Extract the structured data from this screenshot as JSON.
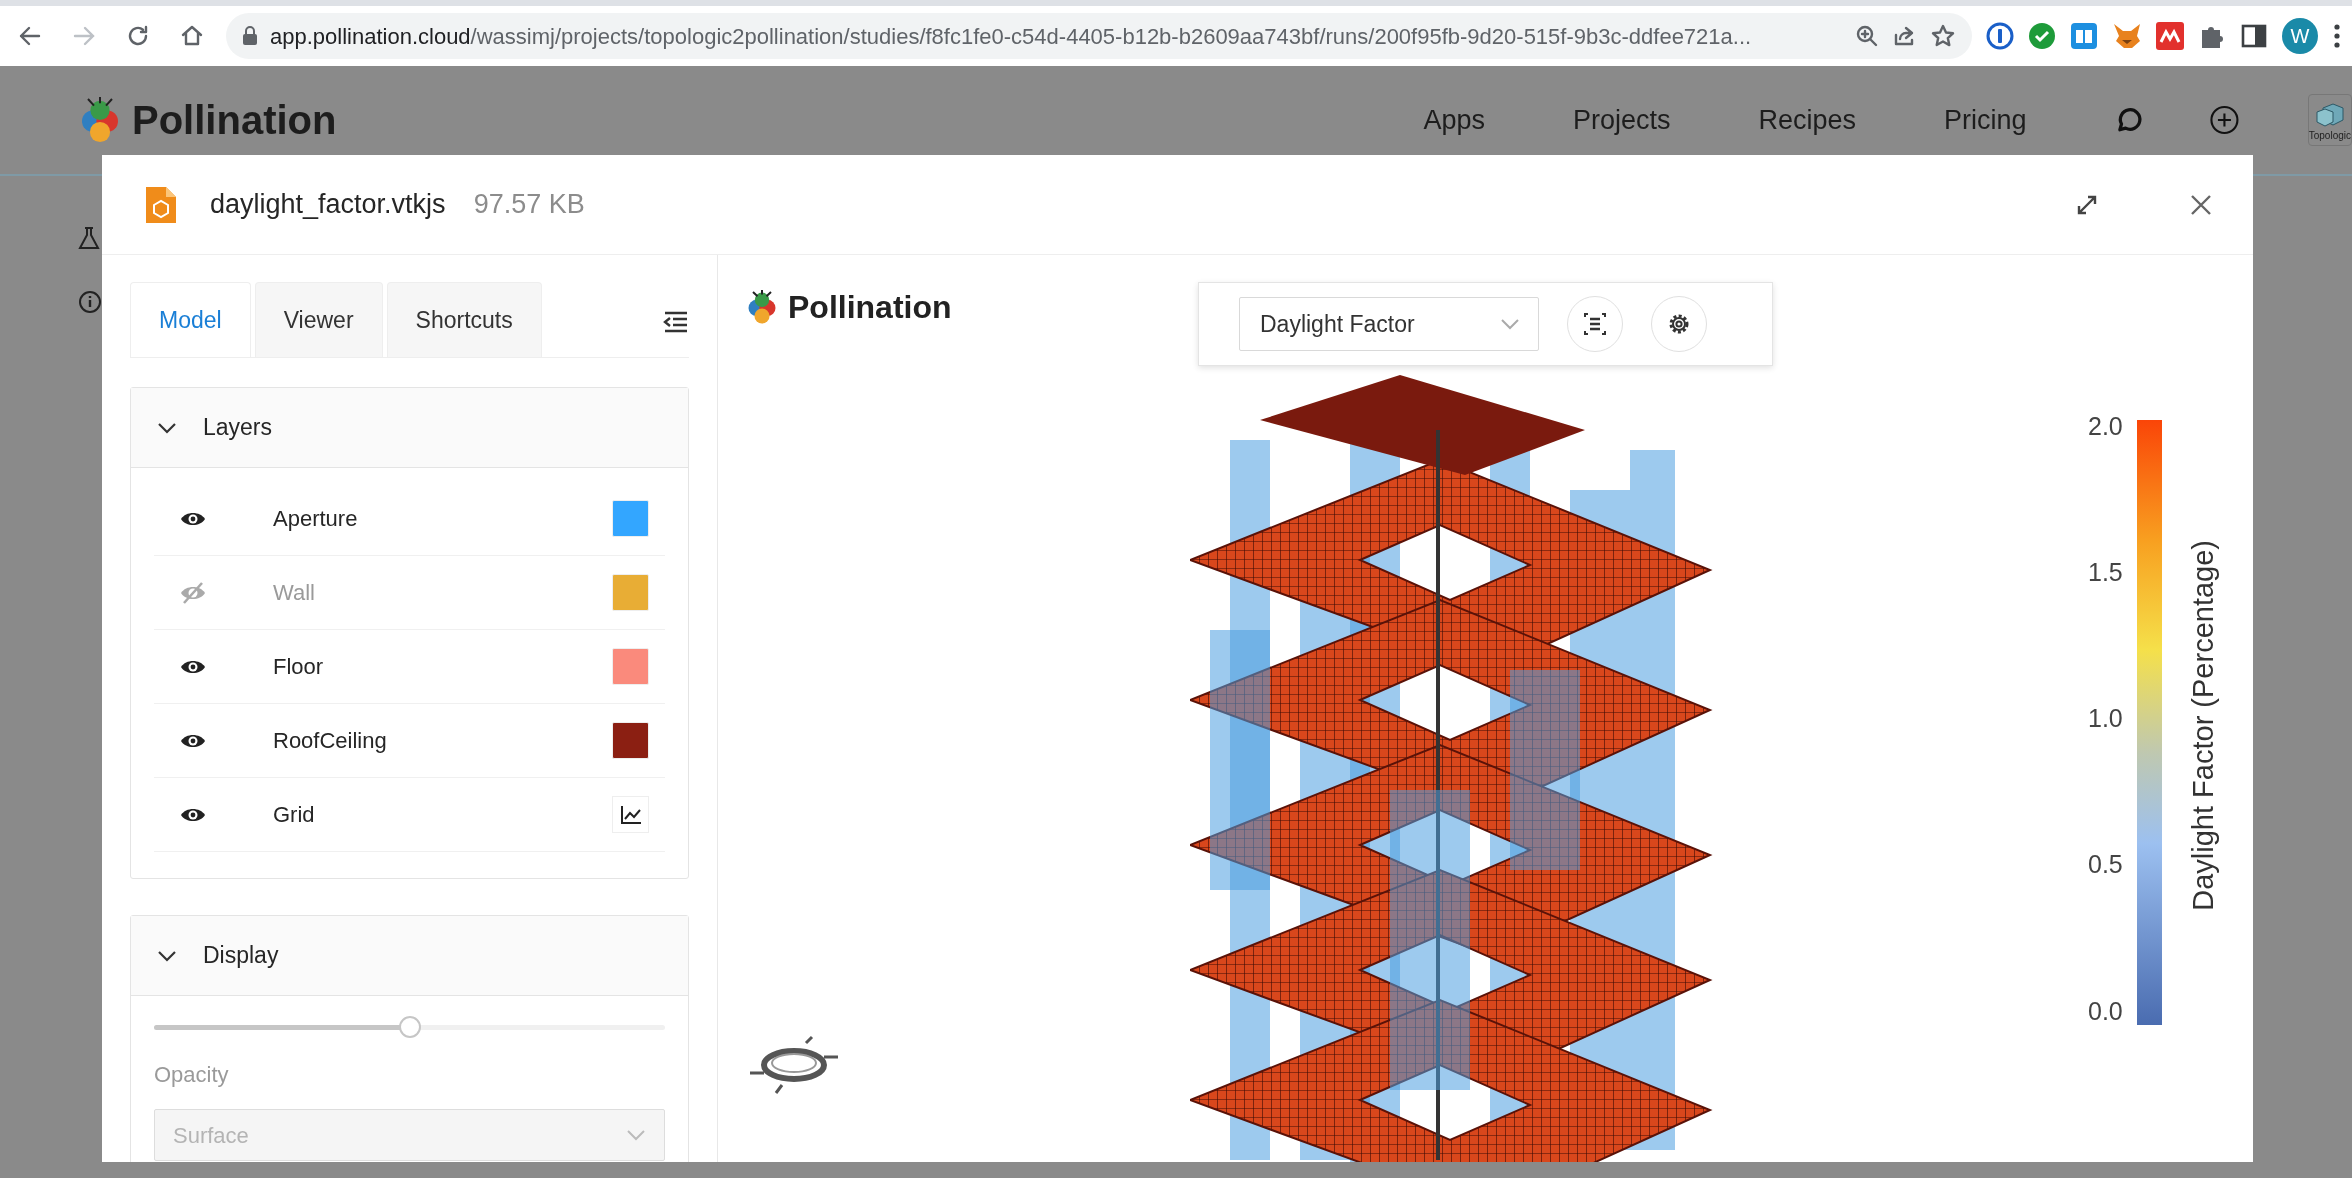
{
  "browser": {
    "url_host": "app.pollination.cloud",
    "url_path": "/wassimj/projects/topologic2pollination/studies/f8fc1fe0-c54d-4405-b12b-b2609aa743bf/runs/200f95fb-9d20-515f-9b3c-ddfee721a...",
    "profile_initial": "W"
  },
  "app_header": {
    "brand": "Pollination",
    "nav": [
      "Apps",
      "Projects",
      "Recipes",
      "Pricing"
    ],
    "account_label": "Topologic"
  },
  "modal": {
    "file_name": "daylight_factor.vtkjs",
    "file_size": "97.57 KB"
  },
  "sidebar": {
    "tabs": [
      {
        "label": "Model",
        "selected": true
      },
      {
        "label": "Viewer",
        "selected": false
      },
      {
        "label": "Shortcuts",
        "selected": false
      }
    ],
    "layers_panel": {
      "title": "Layers",
      "expanded": true,
      "items": [
        {
          "name": "Aperture",
          "visible": true,
          "kind": "swatch",
          "color": "#33a6ff"
        },
        {
          "name": "Wall",
          "visible": false,
          "kind": "swatch",
          "color": "#e8ad35"
        },
        {
          "name": "Floor",
          "visible": true,
          "kind": "swatch",
          "color": "#fa8a7c"
        },
        {
          "name": "RoofCeiling",
          "visible": true,
          "kind": "swatch",
          "color": "#8b1f12"
        },
        {
          "name": "Grid",
          "visible": true,
          "kind": "chart"
        }
      ]
    },
    "display_panel": {
      "title": "Display",
      "expanded": true,
      "opacity": {
        "label": "Opacity",
        "level": 0.5
      },
      "render_mode": {
        "value": "Surface",
        "disabled": true
      }
    }
  },
  "viewer": {
    "brand": "Pollination",
    "result_select": "Daylight Factor",
    "legend": {
      "title": "Daylight Factor (Percentage)",
      "ticks": [
        "2.0",
        "1.5",
        "1.0",
        "0.5",
        "0.0"
      ]
    }
  }
}
